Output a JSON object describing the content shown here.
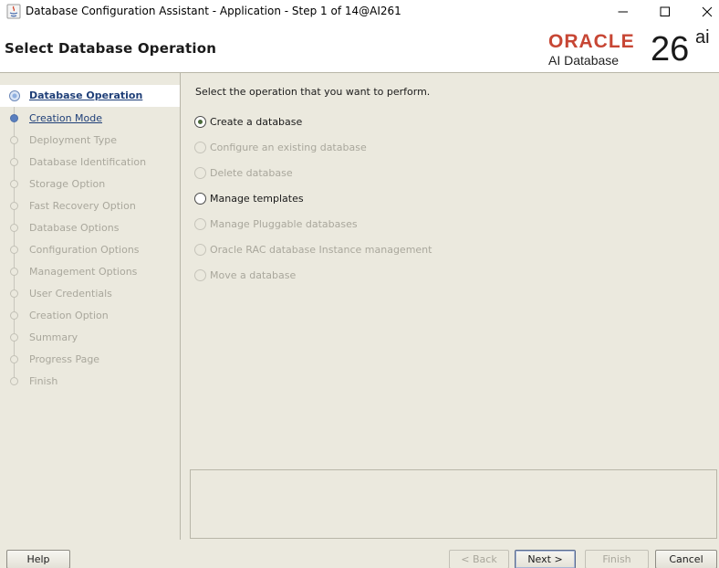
{
  "window": {
    "title": "Database Configuration Assistant - Application - Step 1 of 14@AI261"
  },
  "header": {
    "page_title": "Select Database Operation",
    "logo": {
      "brand": "ORACLE",
      "product": "AI Database",
      "version": "26",
      "suffix": "ai",
      "brand_color": "#c74634"
    }
  },
  "steps": [
    {
      "label": "Database Operation",
      "state": "active"
    },
    {
      "label": "Creation Mode",
      "state": "next"
    },
    {
      "label": "Deployment Type",
      "state": "disabled"
    },
    {
      "label": "Database Identification",
      "state": "disabled"
    },
    {
      "label": "Storage Option",
      "state": "disabled"
    },
    {
      "label": "Fast Recovery Option",
      "state": "disabled"
    },
    {
      "label": "Database Options",
      "state": "disabled"
    },
    {
      "label": "Configuration Options",
      "state": "disabled"
    },
    {
      "label": "Management Options",
      "state": "disabled"
    },
    {
      "label": "User Credentials",
      "state": "disabled"
    },
    {
      "label": "Creation Option",
      "state": "disabled"
    },
    {
      "label": "Summary",
      "state": "disabled"
    },
    {
      "label": "Progress Page",
      "state": "disabled"
    },
    {
      "label": "Finish",
      "state": "disabled"
    }
  ],
  "main": {
    "prompt": "Select the operation that you want to perform.",
    "options": [
      {
        "label": "Create a database",
        "checked": true,
        "enabled": true
      },
      {
        "label": "Configure an existing database",
        "checked": false,
        "enabled": false
      },
      {
        "label": "Delete database",
        "checked": false,
        "enabled": false
      },
      {
        "label": "Manage templates",
        "checked": false,
        "enabled": true
      },
      {
        "label": "Manage Pluggable databases",
        "checked": false,
        "enabled": false
      },
      {
        "label": "Oracle RAC database Instance management",
        "checked": false,
        "enabled": false
      },
      {
        "label": "Move a database",
        "checked": false,
        "enabled": false
      }
    ]
  },
  "buttons": {
    "help": "Help",
    "back": "< Back",
    "next": "Next >",
    "finish": "Finish",
    "cancel": "Cancel"
  }
}
